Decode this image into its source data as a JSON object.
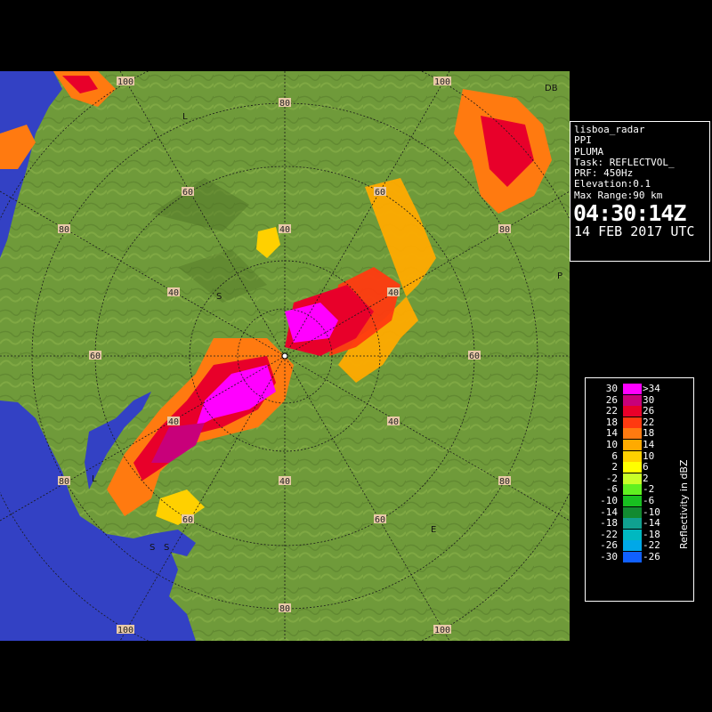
{
  "map": {
    "ring_labels": [
      {
        "ring": 40,
        "labels": [
          "40",
          "40",
          "40",
          "40",
          "40",
          "40"
        ]
      },
      {
        "ring": 60,
        "labels": [
          "60",
          "60",
          "60",
          "60",
          "60",
          "60"
        ]
      },
      {
        "ring": 80,
        "labels": [
          "80",
          "80",
          "80",
          "80",
          "80",
          "80"
        ]
      },
      {
        "ring": 100,
        "labels": [
          "100",
          "100",
          "100",
          "100"
        ]
      }
    ],
    "place_marks": [
      "L",
      "S",
      "P",
      "E",
      "L",
      "S",
      "S",
      "DB"
    ],
    "colors": {
      "land": "#6f9a3a",
      "sea": "#3341c4",
      "range_rings": "#1a1a1a"
    }
  },
  "info": {
    "radar_name": "lisboa_radar",
    "product": "PPI",
    "variable": "PLUMA",
    "task": "Task: REFLECTVOL_",
    "prf": "PRF: 450Hz",
    "elevation": "Elevation:0.1",
    "max_range": "Max Range:90 km",
    "time": "04:30:14Z",
    "date": "14 FEB 2017 UTC"
  },
  "legend": {
    "title": "Reflectivity in dBZ",
    "rows": [
      {
        "left": "30",
        "right": ">34",
        "color": "#ff00ff"
      },
      {
        "left": "26",
        "right": "30",
        "color": "#c8007a"
      },
      {
        "left": "22",
        "right": "26",
        "color": "#e8002a"
      },
      {
        "left": "18",
        "right": "22",
        "color": "#ff3a10"
      },
      {
        "left": "14",
        "right": "18",
        "color": "#ff7a10"
      },
      {
        "left": "10",
        "right": "14",
        "color": "#ffaa00"
      },
      {
        "left": "6",
        "right": "10",
        "color": "#ffd000"
      },
      {
        "left": "2",
        "right": "6",
        "color": "#ffff00"
      },
      {
        "left": "-2",
        "right": "2",
        "color": "#c8ff28"
      },
      {
        "left": "-6",
        "right": "-2",
        "color": "#60f020"
      },
      {
        "left": "-10",
        "right": "-6",
        "color": "#18c020"
      },
      {
        "left": "-14",
        "right": "-10",
        "color": "#128a30"
      },
      {
        "left": "-18",
        "right": "-14",
        "color": "#10a090"
      },
      {
        "left": "-22",
        "right": "-18",
        "color": "#00b8c0"
      },
      {
        "left": "-26",
        "right": "-22",
        "color": "#00a8e8"
      },
      {
        "left": "-30",
        "right": "-26",
        "color": "#1060ff"
      }
    ]
  }
}
